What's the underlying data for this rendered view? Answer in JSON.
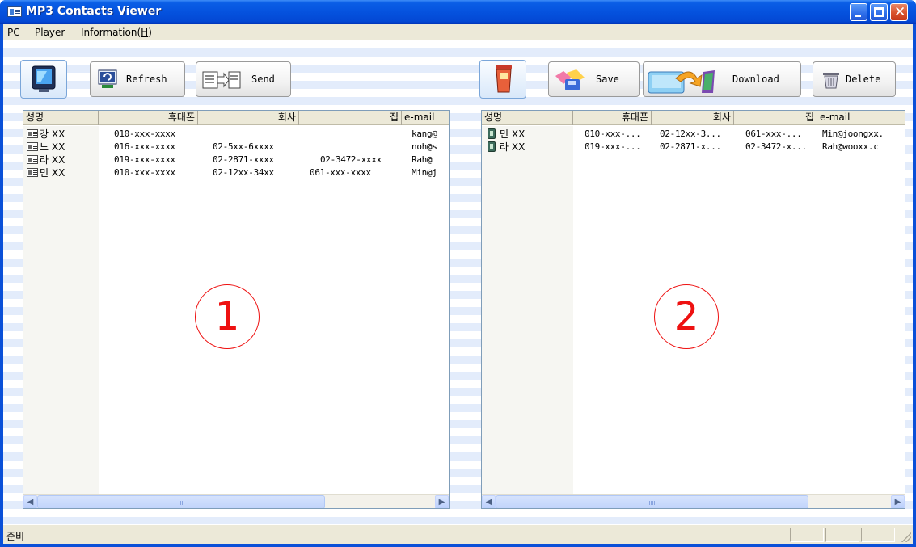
{
  "window": {
    "title": "MP3 Contacts Viewer"
  },
  "menu": [
    {
      "label": "PC"
    },
    {
      "label": "Player"
    },
    {
      "label_main": "Information(",
      "label_accel": "H",
      "label_end": ")"
    }
  ],
  "left_toolbar": {
    "refresh_label": "Refresh",
    "send_label": "Send"
  },
  "right_toolbar": {
    "save_label": "Save",
    "download_label": "Download",
    "delete_label": "Delete"
  },
  "columns": [
    "성명",
    "휴대폰",
    "회사",
    "집",
    "e-mail"
  ],
  "left_list": {
    "rows": [
      {
        "name": "강 XX",
        "mobile": "010-xxx-xxxx",
        "company": "",
        "home": "",
        "email": "kang@"
      },
      {
        "name": "노 XX",
        "mobile": "016-xxx-xxxx",
        "company": "02-5xx-6xxxx",
        "home": "",
        "email": "noh@s"
      },
      {
        "name": "라 XX",
        "mobile": "019-xxx-xxxx",
        "company": "02-2871-xxxx",
        "home": "02-3472-xxxx",
        "email": "Rah@"
      },
      {
        "name": "민 XX",
        "mobile": "010-xxx-xxxx",
        "company": "02-12xx-34xx",
        "home": "061-xxx-xxxx",
        "email": "Min@j"
      }
    ],
    "marker": "1"
  },
  "right_list": {
    "rows": [
      {
        "name": "민 XX",
        "mobile": "010-xxx-...",
        "company": "02-12xx-3...",
        "home": "061-xxx-...",
        "email": "Min@joongxx."
      },
      {
        "name": "라 XX",
        "mobile": "019-xxx-...",
        "company": "02-2871-x...",
        "home": "02-3472-x...",
        "email": "Rah@wooxx.c"
      }
    ],
    "marker": "2"
  },
  "status": {
    "text": "준비"
  },
  "colors": {
    "title_blue": "#0552de",
    "close_red": "#d9532e",
    "marker_red": "#ee1111"
  }
}
